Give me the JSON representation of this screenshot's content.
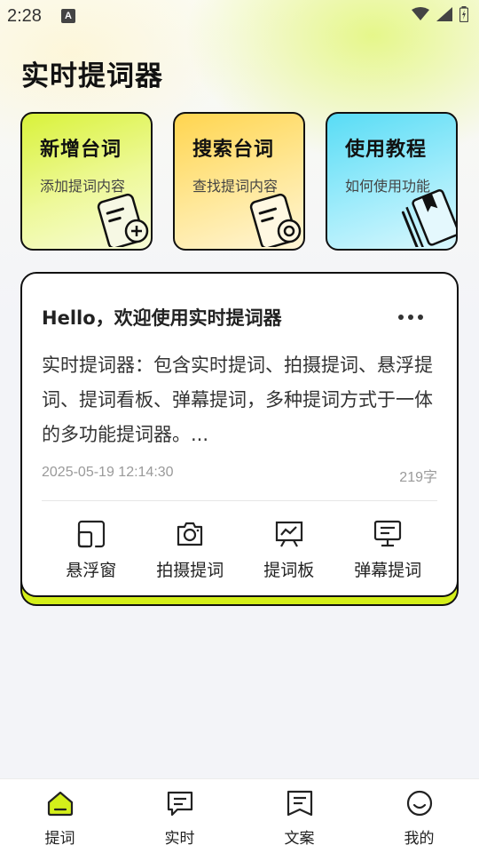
{
  "status_bar": {
    "time": "2:28",
    "notification_glyph": "A"
  },
  "app": {
    "title": "实时提词器"
  },
  "feature_cards": [
    {
      "title": "新增台词",
      "subtitle": "添加提词内容",
      "icon": "add-script-icon",
      "color": "#d9f23a"
    },
    {
      "title": "搜索台词",
      "subtitle": "查找提词内容",
      "icon": "search-script-icon",
      "color": "#ffd54f"
    },
    {
      "title": "使用教程",
      "subtitle": "如何使用功能",
      "icon": "tutorial-book-icon",
      "color": "#58dcf5"
    }
  ],
  "script_card": {
    "title": "Hello，欢迎使用实时提词器",
    "body": "实时提词器：包含实时提词、拍摄提词、悬浮提词、提词看板、弹幕提词，多种提词方式于一体的多功能提词器。...",
    "datetime": "2025-05-19 12:14:30",
    "char_count": "219字",
    "actions": [
      {
        "label": "悬浮窗",
        "icon": "floating-window-icon"
      },
      {
        "label": "拍摄提词",
        "icon": "camera-icon"
      },
      {
        "label": "提词板",
        "icon": "board-icon"
      },
      {
        "label": "弹幕提词",
        "icon": "danmaku-icon"
      }
    ]
  },
  "tab_bar": {
    "tabs": [
      {
        "label": "提词",
        "icon": "home-icon",
        "active": true
      },
      {
        "label": "实时",
        "icon": "chat-icon",
        "active": false
      },
      {
        "label": "文案",
        "icon": "document-icon",
        "active": false
      },
      {
        "label": "我的",
        "icon": "smile-icon",
        "active": false
      }
    ]
  },
  "colors": {
    "accent": "#d4ef1a",
    "background": "#f3f4f8"
  }
}
